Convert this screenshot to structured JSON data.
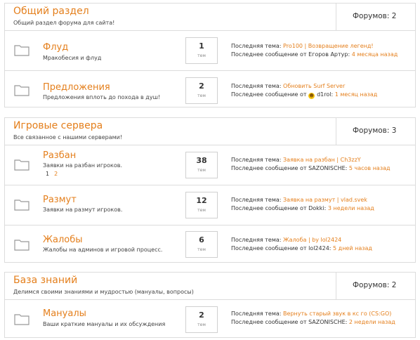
{
  "sections": [
    {
      "title": "Общий раздел",
      "description": "Общий раздел форума для сайта!",
      "forums_count": "Форумов: 2",
      "forums": [
        {
          "title": "Флуд",
          "description": "Мракобесия и флуд",
          "topics": "1",
          "topics_label": "тем",
          "last_topic_prefix": "Последняя тема:",
          "last_topic": "Pro100 | Возвращение легенд!",
          "last_message_prefix": "Последнее сообщение от",
          "last_author": "Егоров Артур:",
          "last_time": "4 месяца назад"
        },
        {
          "title": "Предложения",
          "description": "Предложения вплоть до похода в душ!",
          "topics": "2",
          "topics_label": "тем",
          "last_topic_prefix": "Последняя тема:",
          "last_topic": "Обновить Surf Server",
          "last_message_prefix": "Последнее сообщение от",
          "last_author": "d1rol:",
          "last_time": "1 месяц назад"
        }
      ]
    },
    {
      "title": "Игровые сервера",
      "description": "Все связанное с нашими серверами!",
      "forums_count": "Форумов: 3",
      "forums": [
        {
          "title": "Разбан",
          "description": "Заявки на разбан игроков.",
          "pages": [
            "1",
            "2"
          ],
          "topics": "38",
          "topics_label": "тем",
          "last_topic_prefix": "Последняя тема:",
          "last_topic": "Заявка на разбан | Ch3zzY",
          "last_message_prefix": "Последнее сообщение от",
          "last_author": "SAZONISCHE:",
          "last_time": "5 часов назад"
        },
        {
          "title": "Размут",
          "description": "Заявки на размут игроков.",
          "topics": "12",
          "topics_label": "тем",
          "last_topic_prefix": "Последняя тема:",
          "last_topic": "Заявка на размут | vlad.svek",
          "last_message_prefix": "Последнее сообщение от",
          "last_author": "Dokki:",
          "last_time": "3 недели назад"
        },
        {
          "title": "Жалобы",
          "description": "Жалобы на админов и игровой процесс.",
          "topics": "6",
          "topics_label": "тем",
          "last_topic_prefix": "Последняя тема:",
          "last_topic": "Жалоба | by lol2424",
          "last_message_prefix": "Последнее сообщение от",
          "last_author": "lol2424:",
          "last_time": "5 дней назад"
        }
      ]
    },
    {
      "title": "База знаний",
      "description": "Делимся своими знаниями и мудростью (мануалы, вопросы)",
      "forums_count": "Форумов: 2",
      "forums": [
        {
          "title": "Мануалы",
          "description": "Ваши краткие мануалы и их обсуждения",
          "topics": "2",
          "topics_label": "тем",
          "last_topic_prefix": "Последняя тема:",
          "last_topic": "Вернуть старый звук в кс го (CS:GO)",
          "last_message_prefix": "Последнее сообщение от",
          "last_author": "SAZONISCHE:",
          "last_time": "2 недели назад"
        }
      ]
    }
  ],
  "colors": {
    "accent": "#e47f1c",
    "border": "#dcdcdc",
    "text": "#333333"
  },
  "icons": {
    "folder": "folder-icon",
    "avatar": "smiley-avatar-icon"
  }
}
